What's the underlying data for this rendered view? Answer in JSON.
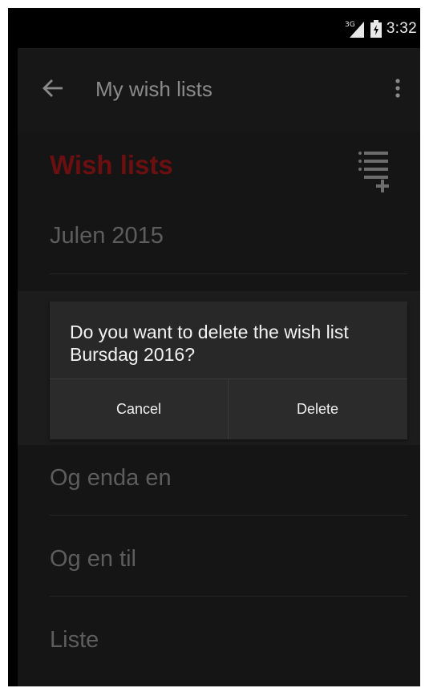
{
  "status_bar": {
    "network_label": "3G",
    "time": "3:32",
    "icons": [
      "signal-icon",
      "battery-icon"
    ]
  },
  "app_bar": {
    "back_icon": "arrow-left-icon",
    "title": "My wish lists",
    "overflow_icon": "more-vert-icon"
  },
  "section": {
    "title": "Wish lists",
    "title_color": "#6b0f10",
    "add_icon": "playlist-add-icon"
  },
  "lists": [
    {
      "label": "Julen 2015"
    },
    {
      "label": "Og enda en"
    },
    {
      "label": "Og en til"
    },
    {
      "label": "Liste"
    }
  ],
  "dialog": {
    "message": "Do you want to delete the wish list Bursdag 2016?",
    "cancel_label": "Cancel",
    "delete_label": "Delete"
  }
}
